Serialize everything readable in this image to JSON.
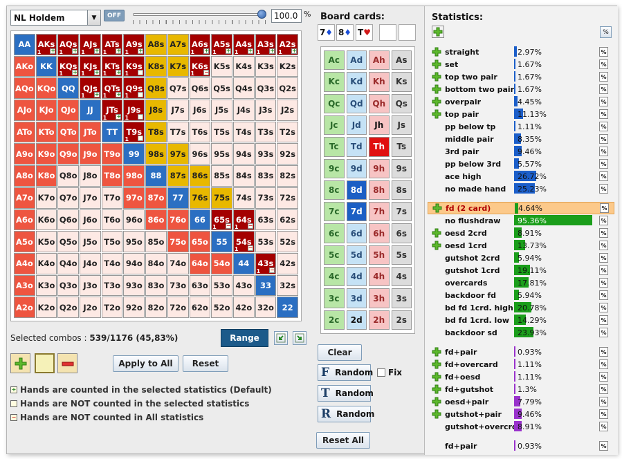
{
  "top": {
    "game_select": "NL Holdem",
    "off_label": "OFF",
    "percent_value": "100.0",
    "percent_sign": "%"
  },
  "range_grid": {
    "rows": [
      [
        "AA",
        "AKs",
        "AQs",
        "AJs",
        "ATs",
        "A9s",
        "A8s",
        "A7s",
        "A6s",
        "A5s",
        "A4s",
        "A3s",
        "A2s"
      ],
      [
        "AKo",
        "KK",
        "KQs",
        "KJs",
        "KTs",
        "K9s",
        "K8s",
        "K7s",
        "K6s",
        "K5s",
        "K4s",
        "K3s",
        "K2s"
      ],
      [
        "AQo",
        "KQo",
        "QQ",
        "QJs",
        "QTs",
        "Q9s",
        "Q8s",
        "Q7s",
        "Q6s",
        "Q5s",
        "Q4s",
        "Q3s",
        "Q2s"
      ],
      [
        "AJo",
        "KJo",
        "QJo",
        "JJ",
        "JTs",
        "J9s",
        "J8s",
        "J7s",
        "J6s",
        "J5s",
        "J4s",
        "J3s",
        "J2s"
      ],
      [
        "ATo",
        "KTo",
        "QTo",
        "JTo",
        "TT",
        "T9s",
        "T8s",
        "T7s",
        "T6s",
        "T5s",
        "T4s",
        "T3s",
        "T2s"
      ],
      [
        "A9o",
        "K9o",
        "Q9o",
        "J9o",
        "T9o",
        "99",
        "98s",
        "97s",
        "96s",
        "95s",
        "94s",
        "93s",
        "92s"
      ],
      [
        "A8o",
        "K8o",
        "Q8o",
        "J8o",
        "T8o",
        "98o",
        "88",
        "87s",
        "86s",
        "85s",
        "84s",
        "83s",
        "82s"
      ],
      [
        "A7o",
        "K7o",
        "Q7o",
        "J7o",
        "T7o",
        "97o",
        "87o",
        "77",
        "76s",
        "75s",
        "74s",
        "73s",
        "72s"
      ],
      [
        "A6o",
        "K6o",
        "Q6o",
        "J6o",
        "T6o",
        "96o",
        "86o",
        "76o",
        "66",
        "65s",
        "64s",
        "63s",
        "62s"
      ],
      [
        "A5o",
        "K5o",
        "Q5o",
        "J5o",
        "T5o",
        "95o",
        "85o",
        "75o",
        "65o",
        "55",
        "54s",
        "53s",
        "52s"
      ],
      [
        "A4o",
        "K4o",
        "Q4o",
        "J4o",
        "T4o",
        "94o",
        "84o",
        "74o",
        "64o",
        "54o",
        "44",
        "43s",
        "42s"
      ],
      [
        "A3o",
        "K3o",
        "Q3o",
        "J3o",
        "T3o",
        "93o",
        "83o",
        "73o",
        "63o",
        "53o",
        "43o",
        "33",
        "32s"
      ],
      [
        "A2o",
        "K2o",
        "Q2o",
        "J2o",
        "T2o",
        "92o",
        "82o",
        "72o",
        "62o",
        "52o",
        "42o",
        "32o",
        "22"
      ]
    ],
    "states": [
      "PDDDDDYYDDDDD",
      "RPDDDDYYDLLLL",
      "RRPDDDYLLLLLL",
      "RRRPDDYLLLLLL",
      "RRRRPDYLLLLLL",
      "RRRRRPYYLLLLL",
      "RRLLRRPYYLLLL",
      "RLLLLRRPYYLLL",
      "RLLLLLRRPDDLL",
      "RLLLLLLRRPDLL",
      "RLLLLLLLRRPDL",
      "RLLLLLLLLLLPL",
      "RLLLLLLLLLLLP"
    ],
    "counts": {
      "AKs": "1",
      "AQs": "1",
      "AJs": "1",
      "ATs": "1",
      "A9s": "1",
      "A6s": "1",
      "A5s": "1",
      "A4s": "1",
      "A3s": "1",
      "A2s": "1",
      "KQs": "1",
      "KJs": "1",
      "KTs": "1",
      "K9s": "1",
      "K6s": "1",
      "QJs": "1",
      "QTs": "1",
      "Q9s": "1",
      "JTs": "1",
      "J9s": "1",
      "T9s": "1",
      "65s": "1",
      "64s": "1",
      "54s": "1",
      "43s": "1"
    },
    "tags": {
      "AKs": "+",
      "AQs": "+",
      "AJs": "+",
      "ATs": "+",
      "A9s": "+",
      "A6s": "+",
      "A5s": "+",
      "A4s": "+",
      "A3s": "+",
      "A2s": "+",
      "KQs": "+",
      "KJs": "+",
      "KTs": "+",
      "K9s": "",
      "K6s": "-",
      "QJs": "+",
      "QTs": "+",
      "Q9s": "",
      "JTs": "+",
      "J9s": "",
      "T9s": "",
      "65s": "-",
      "64s": "-",
      "54s": "-",
      "43s": "-"
    }
  },
  "below_grid": {
    "selected_label": "Selected combos : ",
    "selected_value": "539/1176 (45,83%)",
    "range_button": "Range",
    "apply_button": "Apply to All",
    "reset_button": "Reset"
  },
  "legend": [
    {
      "mark": "+",
      "text": "Hands are counted in the selected statistics (Default)"
    },
    {
      "mark": "",
      "text": "Hands are NOT counted in the selected statistics"
    },
    {
      "mark": "-",
      "text": "Hands are NOT counted in All statistics"
    }
  ],
  "board": {
    "title": "Board cards:",
    "slots": [
      {
        "rank": "7",
        "suit": "♦",
        "color": "#1b4fd8"
      },
      {
        "rank": "8",
        "suit": "♦",
        "color": "#1b4fd8"
      },
      {
        "rank": "T",
        "suit": "♥",
        "color": "#d01818"
      },
      {
        "rank": "",
        "suit": "",
        "color": "#000"
      },
      {
        "rank": "",
        "suit": "",
        "color": "#000"
      }
    ],
    "ranks": [
      "A",
      "K",
      "Q",
      "J",
      "T",
      "9",
      "8",
      "7",
      "6",
      "5",
      "4",
      "3",
      "2"
    ],
    "suits": [
      "c",
      "d",
      "h",
      "s"
    ],
    "selected": [
      "8d",
      "7d",
      "Th"
    ],
    "clear_button": "Clear",
    "random_flop": "Random",
    "random_turn": "Random",
    "random_river": "Random",
    "random_flop_letter": "F",
    "random_turn_letter": "T",
    "random_river_letter": "R",
    "fix_label": "Fix",
    "reset_all_button": "Reset All"
  },
  "stats": {
    "title": "Statistics:",
    "pct_button": "%",
    "made_hands": [
      {
        "label": "straight",
        "value": "2.97%",
        "pct": 2.97,
        "plus": true
      },
      {
        "label": "set",
        "value": "1.67%",
        "pct": 1.67,
        "plus": true
      },
      {
        "label": "top two pair",
        "value": "1.67%",
        "pct": 1.67,
        "plus": true
      },
      {
        "label": "bottom two pair",
        "value": "1.67%",
        "pct": 1.67,
        "plus": true
      },
      {
        "label": "overpair",
        "value": "4.45%",
        "pct": 4.45,
        "plus": true
      },
      {
        "label": "top pair",
        "value": "11.13%",
        "pct": 11.13,
        "plus": true
      },
      {
        "label": "pp below tp",
        "value": "1.11%",
        "pct": 1.11,
        "plus": false
      },
      {
        "label": "middle pair",
        "value": "8.35%",
        "pct": 8.35,
        "plus": false
      },
      {
        "label": "3rd pair",
        "value": "9.46%",
        "pct": 9.46,
        "plus": false
      },
      {
        "label": "pp below 3rd",
        "value": "5.57%",
        "pct": 5.57,
        "plus": false
      },
      {
        "label": "ace high",
        "value": "26.72%",
        "pct": 26.72,
        "plus": false
      },
      {
        "label": "no made hand",
        "value": "25.23%",
        "pct": 25.23,
        "plus": false
      }
    ],
    "draws": [
      {
        "label": "fd (2 card)",
        "value": "4.64%",
        "pct": 4.64,
        "plus": true,
        "highlight": true
      },
      {
        "label": "no flushdraw",
        "value": "95.36%",
        "pct": 95.36,
        "plus": false
      },
      {
        "label": "oesd 2crd",
        "value": "8.91%",
        "pct": 8.91,
        "plus": true
      },
      {
        "label": "oesd 1crd",
        "value": "13.73%",
        "pct": 13.73,
        "plus": true
      },
      {
        "label": "gutshot 2crd",
        "value": "5.94%",
        "pct": 5.94,
        "plus": false
      },
      {
        "label": "gutshot 1crd",
        "value": "19.11%",
        "pct": 19.11,
        "plus": false
      },
      {
        "label": "overcards",
        "value": "17.81%",
        "pct": 17.81,
        "plus": false
      },
      {
        "label": "backdoor fd",
        "value": "5.94%",
        "pct": 5.94,
        "plus": false
      },
      {
        "label": "bd fd 1crd. high",
        "value": "20.78%",
        "pct": 20.78,
        "plus": false
      },
      {
        "label": "bd fd 1crd. low",
        "value": "14.29%",
        "pct": 14.29,
        "plus": false
      },
      {
        "label": "backdoor sd",
        "value": "23.93%",
        "pct": 23.93,
        "plus": false
      }
    ],
    "combos": [
      {
        "label": "fd+pair",
        "value": "0.93%",
        "pct": 0.93,
        "plus": true
      },
      {
        "label": "fd+overcard",
        "value": "1.11%",
        "pct": 1.11,
        "plus": true
      },
      {
        "label": "fd+oesd",
        "value": "1.11%",
        "pct": 1.11,
        "plus": true
      },
      {
        "label": "fd+gutshot",
        "value": "1.3%",
        "pct": 1.3,
        "plus": true
      },
      {
        "label": "oesd+pair",
        "value": "7.79%",
        "pct": 7.79,
        "plus": true
      },
      {
        "label": "gutshot+pair",
        "value": "9.46%",
        "pct": 9.46,
        "plus": true
      },
      {
        "label": "gutshot+overcrd",
        "value": "8.91%",
        "pct": 8.91,
        "plus": false
      }
    ],
    "extra": [
      {
        "label": "fd+pair",
        "value": "0.93%",
        "pct": 0.93,
        "plus": false
      }
    ]
  },
  "colors": {
    "pair_blue": "#2b6fc2",
    "suited_dark_red": "#a40000",
    "suited_yellow": "#e8b800",
    "offsuit_red": "#ee5540",
    "light_unselected": "#fde9e4",
    "card_club": "#b8e6a6",
    "card_diamond": "#c5e2f5",
    "card_heart": "#f7c4c4",
    "card_spade": "#dcdcdc",
    "bar_blue": "#1b5ec9",
    "bar_green": "#1b9e1b",
    "bar_purple": "#9932cc"
  }
}
